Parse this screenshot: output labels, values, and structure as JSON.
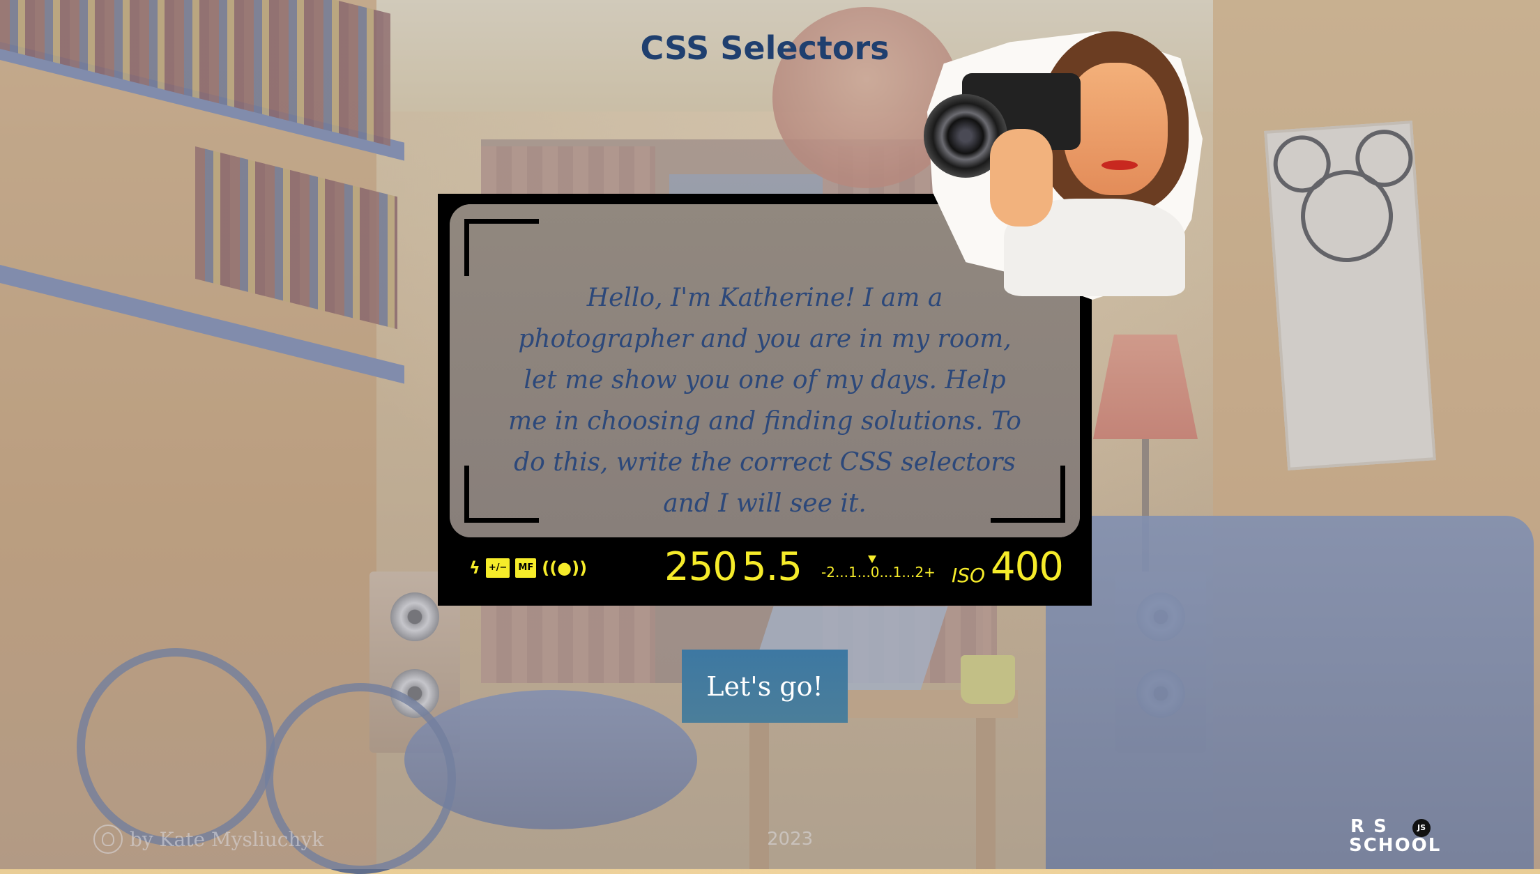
{
  "page": {
    "title": "CSS Selectors"
  },
  "intro": {
    "text": "Hello, I'm Katherine! I am a photographer and you are in my room, let me show you one of my days. Help me in choosing and finding solutions. To do this, write the correct CSS selectors and I will see it."
  },
  "camera_status": {
    "icons": [
      "flash-icon",
      "exposure-compensation-icon",
      "manual-focus-icon",
      "vibration-reduction-icon"
    ],
    "mf_label": "MF",
    "shutter_speed": "250",
    "aperture": "5.5",
    "exposure_scale": "-2...1...0...1...2+",
    "iso_label": "ISO",
    "iso_value": "400",
    "display_color": "#f6ec2a"
  },
  "actions": {
    "start_label": "Let's go!"
  },
  "footer": {
    "author": "by Kate Mysliuchyk",
    "year": "2023",
    "logo": {
      "line1": "R  S",
      "line2": "SCHOOL",
      "badge": "JS"
    }
  },
  "colors": {
    "title": "#1f3f6f",
    "intro_text": "#2d4a7d",
    "button": "#3d78a2",
    "frame": "#000000"
  }
}
